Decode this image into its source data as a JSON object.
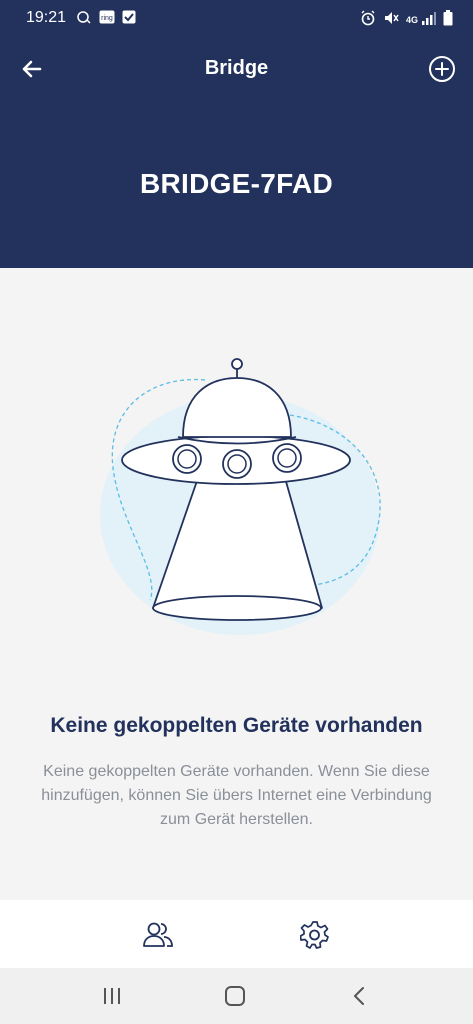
{
  "status_bar": {
    "time": "19:21",
    "left_icons": [
      "notification-icon",
      "ring-app-icon",
      "checkbox-icon"
    ],
    "right_icons": [
      "alarm-icon",
      "mute-icon",
      "signal-4g-icon",
      "battery-icon"
    ],
    "network_label": "4G"
  },
  "header": {
    "title": "Bridge",
    "device_name": "BRIDGE-7FAD",
    "background": "#22325c"
  },
  "empty_state": {
    "title": "Keine gekoppelten Geräte vorhanden",
    "description": "Keine gekoppelten Geräte vorhanden. Wenn Sie diese hinzufügen, können Sie übers Internet eine Verbindung zum Gerät herstellen.",
    "illustration": "ufo-illustration"
  },
  "bottom_nav": {
    "items": [
      {
        "icon": "users-icon"
      },
      {
        "icon": "settings-icon"
      }
    ]
  },
  "system_nav": {
    "items": [
      "recent-apps-icon",
      "home-icon",
      "back-icon"
    ]
  },
  "colors": {
    "accent": "#22325c",
    "text_muted": "#8a8f98",
    "illustration_bg": "#e3f1f8",
    "illustration_dash": "#5bbde4"
  }
}
